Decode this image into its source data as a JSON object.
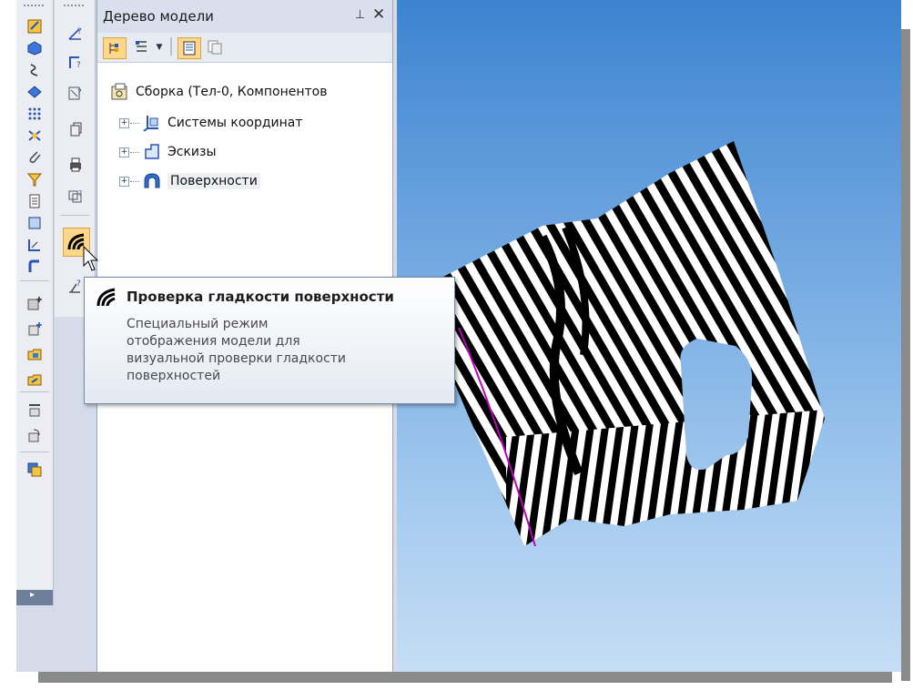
{
  "panel": {
    "title": "Дерево модели",
    "pin_glyph": "ᵖ",
    "close_glyph": "✕",
    "toolbar": [
      "tree-view-icon",
      "tree-mode-icon",
      "dropdown-arrow-icon",
      "properties-icon",
      "copy-properties-icon"
    ]
  },
  "tree": {
    "root": "Сборка (Тел-0, Компонентов",
    "children": [
      {
        "label": "Системы координат",
        "icon": "coordinate-systems-icon"
      },
      {
        "label": "Эскизы",
        "icon": "sketches-icon"
      },
      {
        "label": "Поверхности",
        "icon": "surfaces-icon"
      }
    ]
  },
  "tooltip": {
    "title": "Проверка гладкости поверхности",
    "line1": "Специальный режим",
    "line2": "отображения модели для",
    "line3": "визуальной проверки гладкости",
    "line4": "поверхностей",
    "icon": "zebra-stripes-icon"
  },
  "colors": {
    "viewport_top": "#3d83d0",
    "viewport_bottom": "#c5ddf4",
    "surface_stripes": "#000000",
    "surface_base": "#ffffff",
    "edge_highlight": "#c000c0"
  }
}
